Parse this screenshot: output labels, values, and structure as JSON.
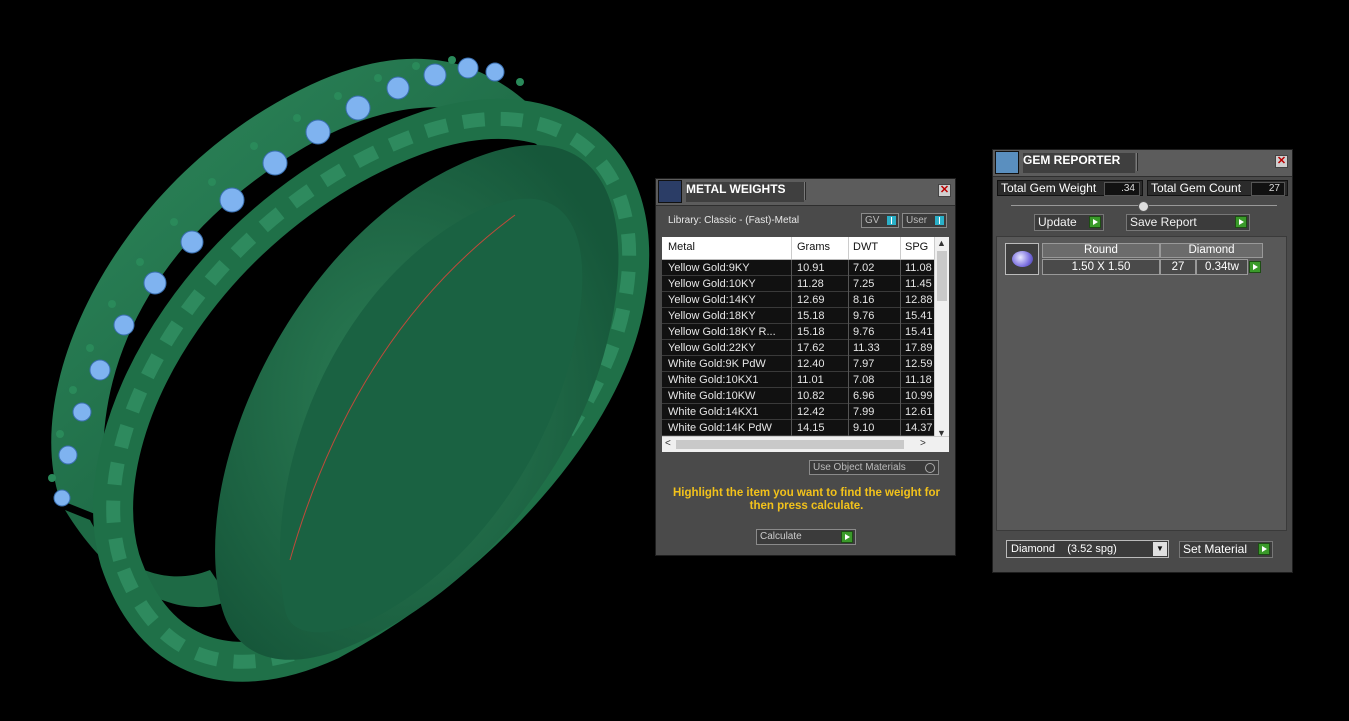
{
  "metal_weights": {
    "title": "METAL WEIGHTS",
    "library": "Library: Classic - (Fast)-Metal",
    "gv_label": "GV",
    "user_label": "User",
    "columns": [
      "Metal",
      "Grams",
      "DWT",
      "SPG"
    ],
    "rows": [
      {
        "metal": "Yellow Gold:9KY",
        "grams": "10.91",
        "dwt": "7.02",
        "spg": "11.08"
      },
      {
        "metal": "Yellow Gold:10KY",
        "grams": "11.28",
        "dwt": "7.25",
        "spg": "11.45"
      },
      {
        "metal": "Yellow Gold:14KY",
        "grams": "12.69",
        "dwt": "8.16",
        "spg": "12.88"
      },
      {
        "metal": "Yellow Gold:18KY",
        "grams": "15.18",
        "dwt": "9.76",
        "spg": "15.41"
      },
      {
        "metal": "Yellow Gold:18KY R...",
        "grams": "15.18",
        "dwt": "9.76",
        "spg": "15.41"
      },
      {
        "metal": "Yellow Gold:22KY",
        "grams": "17.62",
        "dwt": "11.33",
        "spg": "17.89"
      },
      {
        "metal": "White Gold:9K PdW",
        "grams": "12.40",
        "dwt": "7.97",
        "spg": "12.59"
      },
      {
        "metal": "White Gold:10KX1",
        "grams": "11.01",
        "dwt": "7.08",
        "spg": "11.18"
      },
      {
        "metal": "White Gold:10KW",
        "grams": "10.82",
        "dwt": "6.96",
        "spg": "10.99"
      },
      {
        "metal": "White Gold:14KX1",
        "grams": "12.42",
        "dwt": "7.99",
        "spg": "12.61"
      },
      {
        "metal": "White Gold:14K PdW",
        "grams": "14.15",
        "dwt": "9.10",
        "spg": "14.37"
      }
    ],
    "use_object_materials": "Use Object Materials",
    "hint": "Highlight the item you want to find the weight for then press calculate.",
    "calculate": "Calculate"
  },
  "gem_reporter": {
    "title": "GEM REPORTER",
    "total_gem_weight_label": "Total Gem Weight",
    "total_gem_weight": ".34",
    "total_gem_count_label": "Total Gem Count",
    "total_gem_count": "27",
    "update": "Update",
    "save_report": "Save Report",
    "gem": {
      "shape": "Round",
      "material": "Diamond",
      "size": "1.50 X 1.50",
      "count": "27",
      "weight": "0.34tw"
    },
    "material_select": "Diamond    (3.52 spg)",
    "set_material": "Set Material"
  },
  "colors": {
    "ring_green": "#2a7a52",
    "gem_blue": "#7fb3f0",
    "hint_yellow": "#f2c21b",
    "go_green": "#3a9a2a"
  },
  "icons": [
    "close-icon",
    "metal-weights-icon",
    "gem-reporter-icon",
    "go-arrow-icon",
    "dropdown-icon"
  ]
}
